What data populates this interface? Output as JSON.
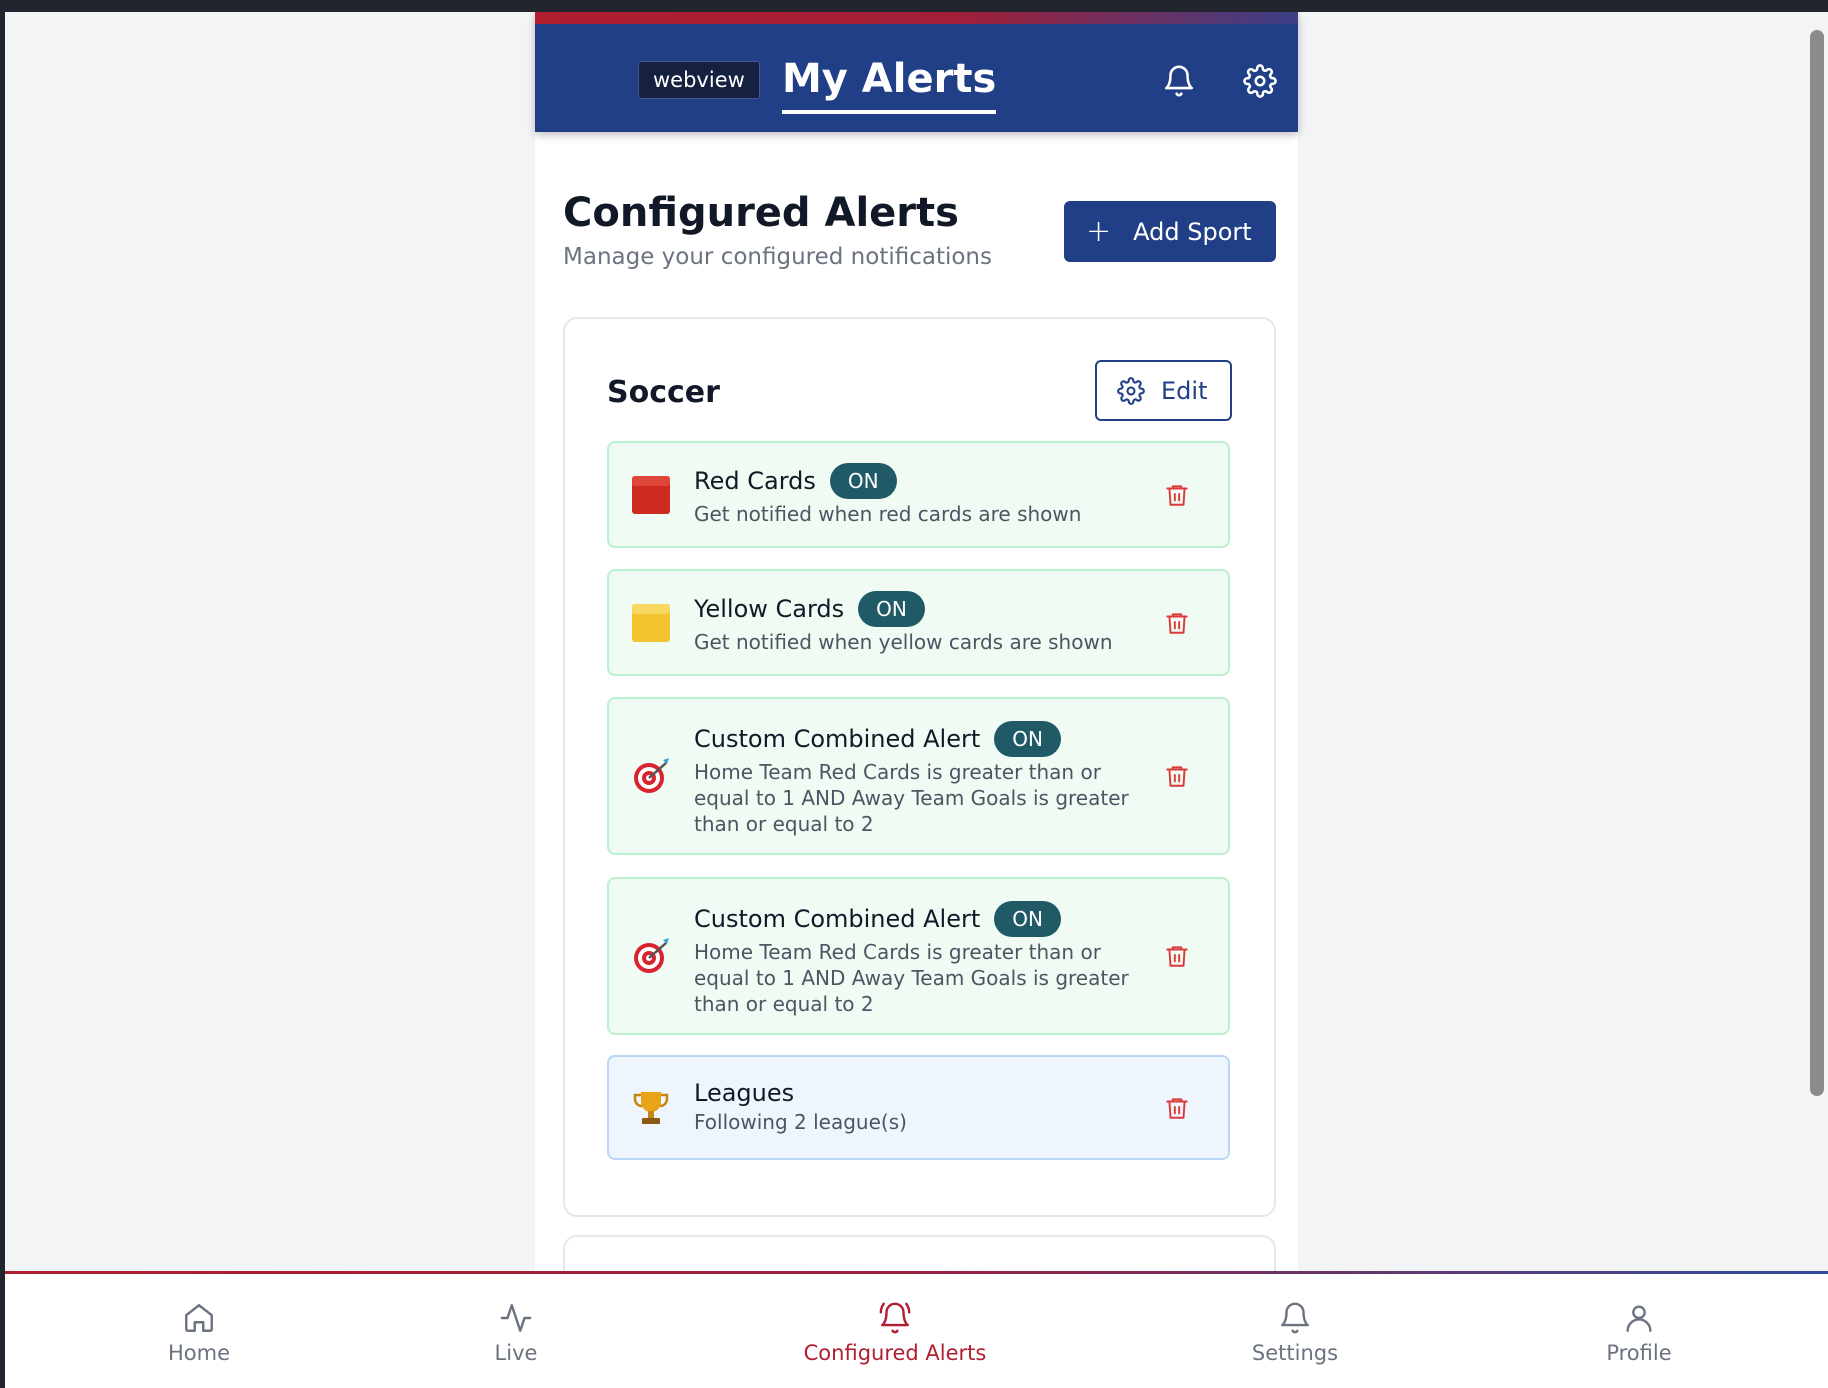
{
  "header": {
    "webview_tag": "webview",
    "title": "My Alerts",
    "bell_icon": "bell-icon",
    "settings_icon": "gear-icon"
  },
  "section": {
    "title": "Configured Alerts",
    "subtitle": "Manage your configured notifications",
    "add_button": "Add Sport"
  },
  "sport_card": {
    "title": "Soccer",
    "edit_label": "Edit",
    "alerts": [
      {
        "name": "Red Cards",
        "badge": "ON",
        "desc_lines": [
          "Get notified when red cards are shown"
        ],
        "icon": "red-square-icon"
      },
      {
        "name": "Yellow Cards",
        "badge": "ON",
        "desc_lines": [
          "Get notified when yellow cards are shown"
        ],
        "icon": "yellow-square-icon"
      },
      {
        "name": "Custom Combined Alert",
        "badge": "ON",
        "desc_lines": [
          "Home Team Red Cards is greater than or",
          "equal to 1 AND Away Team Goals is greater",
          "than or equal to 2"
        ],
        "icon": "target-dart-icon"
      },
      {
        "name": "Custom Combined Alert",
        "badge": "ON",
        "desc_lines": [
          "Home Team Red Cards is greater than or",
          "equal to 1 AND Away Team Goals is greater",
          "than or equal to 2"
        ],
        "icon": "target-dart-icon"
      },
      {
        "name": "Leagues",
        "badge": "",
        "desc_lines": [
          "Following 2 league(s)"
        ],
        "icon": "trophy-icon"
      }
    ]
  },
  "bottom_nav": [
    {
      "label": "Home",
      "icon": "home-icon"
    },
    {
      "label": "Live",
      "icon": "activity-icon"
    },
    {
      "label": "Configured Alerts",
      "icon": "bell-ring-icon",
      "active": true
    },
    {
      "label": "Settings",
      "icon": "bell-icon"
    },
    {
      "label": "Profile",
      "icon": "user-icon"
    }
  ],
  "colors": {
    "brand_blue": "#213f86",
    "brand_red": "#b01e2f",
    "badge_teal": "#1f5a66",
    "alert_green_bg": "#effbf3",
    "league_blue_bg": "#eef5fd"
  }
}
